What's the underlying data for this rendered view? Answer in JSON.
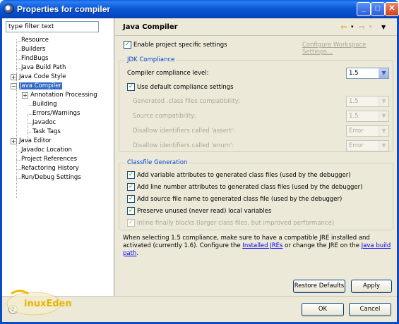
{
  "window": {
    "title": "Properties for compiler"
  },
  "left": {
    "filter_placeholder": "type filter text",
    "tree": [
      {
        "label": "Resource"
      },
      {
        "label": "Builders"
      },
      {
        "label": "FindBugs"
      },
      {
        "label": "Java Build Path"
      },
      {
        "label": "Java Code Style"
      },
      {
        "label": "Java Compiler"
      },
      {
        "label": "Annotation Processing"
      },
      {
        "label": "Building"
      },
      {
        "label": "Errors/Warnings"
      },
      {
        "label": "Javadoc"
      },
      {
        "label": "Task Tags"
      },
      {
        "label": "Java Editor"
      },
      {
        "label": "Javadoc Location"
      },
      {
        "label": "Project References"
      },
      {
        "label": "Refactoring History"
      },
      {
        "label": "Run/Debug Settings"
      }
    ]
  },
  "page": {
    "title": "Java Compiler",
    "enable_specific_label": "Enable project specific settings",
    "configure_link": "Configure Workspace Settings...",
    "jdk": {
      "legend": "JDK Compliance",
      "compliance_label": "Compiler compliance level:",
      "compliance_value": "1.5",
      "use_default_label": "Use default compliance settings",
      "generated_label": "Generated .class files compatibility:",
      "generated_value": "1.5",
      "source_label": "Source compatibility:",
      "source_value": "1.5",
      "assert_label": "Disallow identifiers called 'assert':",
      "assert_value": "Error",
      "enum_label": "Disallow identifiers called 'enum':",
      "enum_value": "Error"
    },
    "classfile": {
      "legend": "Classfile Generation",
      "opt1": "Add variable attributes to generated class files (used by the debugger)",
      "opt2": "Add line number attributes to generated class files (used by the debugger)",
      "opt3": "Add source file name to generated class file (used by the debugger)",
      "opt4": "Preserve unused (never read) local variables",
      "opt5": "Inline finally blocks (larger class files, but improved performance)"
    },
    "info": {
      "part1": "When selecting 1.5 compliance, make sure to have a compatible JRE installed and activated (currently 1.6). Configure the ",
      "link1": "Installed JREs",
      "part2": " or change the JRE on the ",
      "link2": "Java build path",
      "part3": "."
    },
    "restore_defaults": "Restore Defaults",
    "apply": "Apply"
  },
  "footer": {
    "ok": "OK",
    "cancel": "Cancel"
  },
  "watermark": {
    "text": "inuxEden"
  }
}
